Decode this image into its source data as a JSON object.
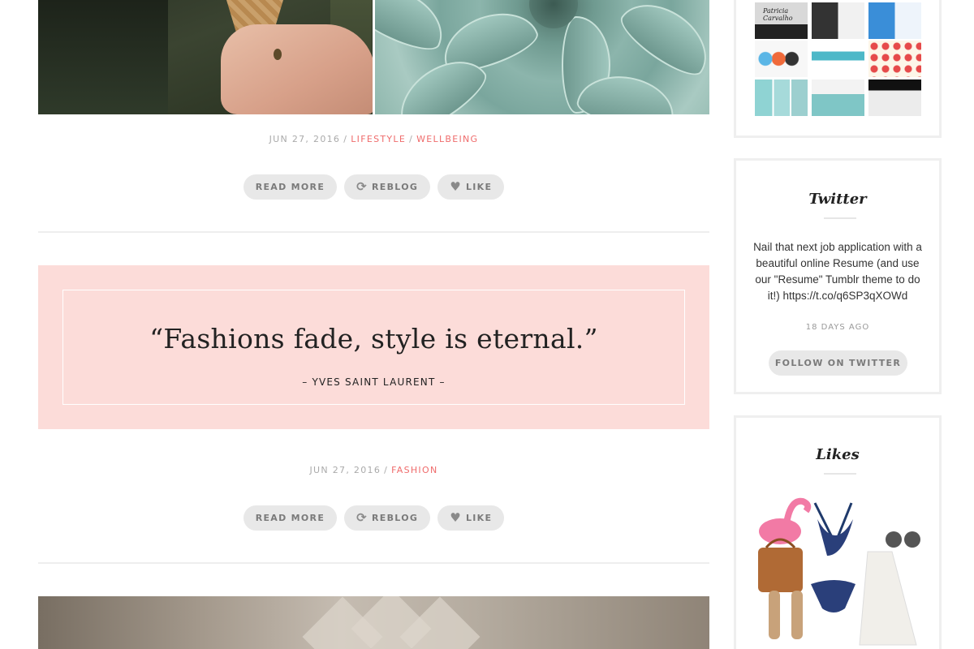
{
  "post1": {
    "date": "JUN 27, 2016",
    "categories": [
      "LIFESTYLE",
      "WELLBEING"
    ],
    "actions": {
      "read_more": "READ MORE",
      "reblog": "REBLOG",
      "like": "LIKE"
    }
  },
  "post2": {
    "quote": "“Fashions fade, style is eternal.”",
    "author": "– YVES SAINT LAURENT –",
    "date": "JUN 27, 2016",
    "categories": [
      "FASHION"
    ],
    "actions": {
      "read_more": "READ MORE",
      "reblog": "REBLOG",
      "like": "LIKE"
    }
  },
  "sidebar": {
    "twitter": {
      "title": "Twitter",
      "tweet": "Nail that next job application with a beautiful online Resume (and use our \"Resume\" Tumblr theme to do it!) https://t.co/q6SP3qXOWd",
      "time": "18 DAYS AGO",
      "follow_label": "FOLLOW ON TWITTER"
    },
    "likes": {
      "title": "Likes"
    },
    "top_widget": {
      "thumbnail_caption": "Patricia Carvalho"
    }
  },
  "colors": {
    "accent": "#ef6b6b",
    "quote_bg": "#fcdcd9",
    "pill_bg": "#e8e8e8",
    "meta": "#aaaaaa"
  },
  "icons": {
    "reblog": "reblog-icon",
    "like": "heart-icon"
  }
}
